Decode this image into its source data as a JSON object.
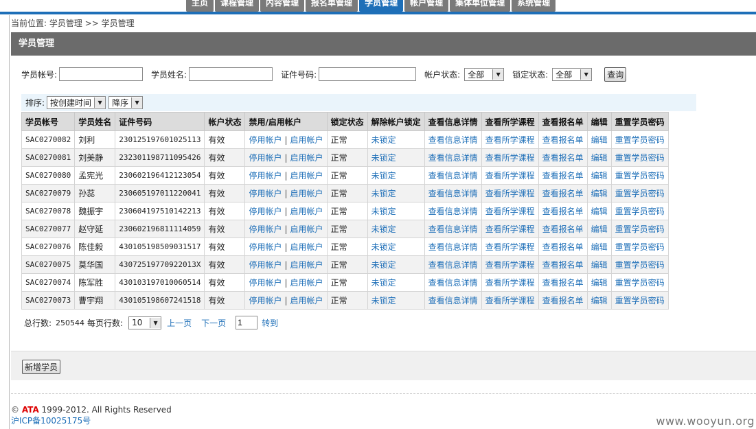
{
  "nav": {
    "tabs": [
      {
        "label": "主页",
        "active": false
      },
      {
        "label": "课程管理",
        "active": false
      },
      {
        "label": "内容管理",
        "active": false
      },
      {
        "label": "报名单管理",
        "active": false
      },
      {
        "label": "学员管理",
        "active": true
      },
      {
        "label": "帐户管理",
        "active": false
      },
      {
        "label": "集体单位管理",
        "active": false
      },
      {
        "label": "系统管理",
        "active": false
      }
    ]
  },
  "breadcrumb": "当前位置: 学员管理 >> 学员管理",
  "panel_title": "学员管理",
  "search": {
    "account_label": "学员帐号:",
    "name_label": "学员姓名:",
    "id_label": "证件号码:",
    "status_label": "帐户状态:",
    "status_value": "全部",
    "lock_label": "锁定状态:",
    "lock_value": "全部",
    "query_button": "查询"
  },
  "sort": {
    "label": "排序:",
    "field_value": "按创建时间",
    "order_value": "降序"
  },
  "table": {
    "headers": [
      "学员帐号",
      "学员姓名",
      "证件号码",
      "帐户状态",
      "禁用/启用帐户",
      "锁定状态",
      "解除帐户锁定",
      "查看信息详情",
      "查看所学课程",
      "查看报名单",
      "编辑",
      "重置学员密码"
    ],
    "rows": [
      {
        "account": "SAC0270082",
        "name": "刘利",
        "id": "230125197601025113",
        "status": "有效",
        "lock": "正常"
      },
      {
        "account": "SAC0270081",
        "name": "刘美静",
        "id": "232301198711095426",
        "status": "有效",
        "lock": "正常"
      },
      {
        "account": "SAC0270080",
        "name": "孟宪光",
        "id": "230602196412123054",
        "status": "有效",
        "lock": "正常"
      },
      {
        "account": "SAC0270079",
        "name": "孙蕊",
        "id": "230605197011220041",
        "status": "有效",
        "lock": "正常"
      },
      {
        "account": "SAC0270078",
        "name": "魏振宇",
        "id": "230604197510142213",
        "status": "有效",
        "lock": "正常"
      },
      {
        "account": "SAC0270077",
        "name": "赵守延",
        "id": "230602196811114059",
        "status": "有效",
        "lock": "正常"
      },
      {
        "account": "SAC0270076",
        "name": "陈佳毅",
        "id": "430105198509031517",
        "status": "有效",
        "lock": "正常"
      },
      {
        "account": "SAC0270075",
        "name": "莫华国",
        "id": "43072519770922013X",
        "status": "有效",
        "lock": "正常"
      },
      {
        "account": "SAC0270074",
        "name": "陈军胜",
        "id": "430103197010060514",
        "status": "有效",
        "lock": "正常"
      },
      {
        "account": "SAC0270073",
        "name": "曹宇翔",
        "id": "430105198607241518",
        "status": "有效",
        "lock": "正常"
      }
    ],
    "links": {
      "disable": "停用帐户",
      "separator": "|",
      "enable": "启用帐户",
      "unlock": "未锁定",
      "detail": "查看信息详情",
      "courses": "查看所学课程",
      "enrollments": "查看报名单",
      "edit": "编辑",
      "reset": "重置学员密码"
    }
  },
  "pager": {
    "total_label": "总行数:",
    "total": "250544",
    "per_page_label": "每页行数:",
    "per_page": "10",
    "prev": "上一页",
    "next": "下一页",
    "page": "1",
    "goto": "转到"
  },
  "actions": {
    "add_student": "新增学员"
  },
  "footer": {
    "copyright_symbol": "©",
    "brand": "ATA",
    "copyright_text": " 1999-2012. All Rights Reserved",
    "icp": "沪ICP备10025175号"
  },
  "watermark": "www.wooyun.org",
  "colors": {
    "accent": "#1e6fb8",
    "header_bar": "#6b6b6b",
    "nav_tab": "#7a7a7a"
  }
}
